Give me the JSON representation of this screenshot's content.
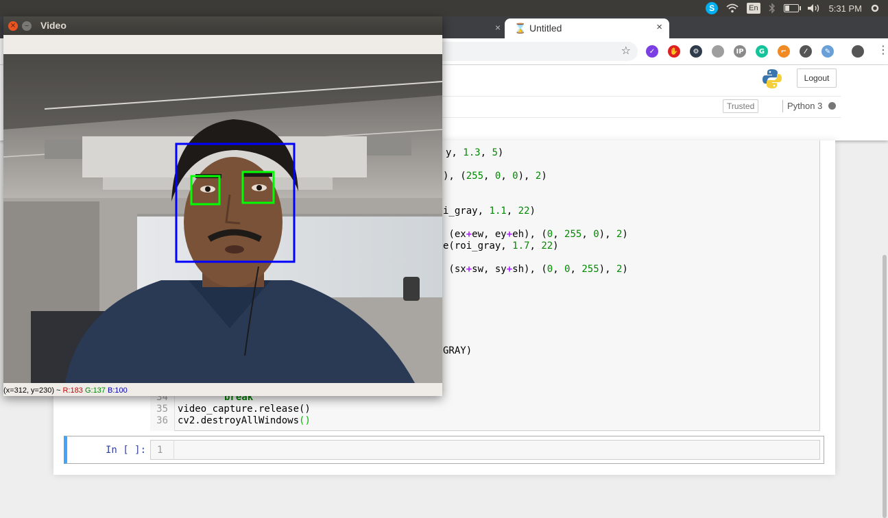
{
  "panel": {
    "lang": "En",
    "time": "5:31 PM",
    "skype_letter": "S"
  },
  "browser": {
    "tab_active_title": "Untitled",
    "tab_close": "×",
    "new_tab": "+",
    "menu_glyph": "⋮",
    "star_glyph": "☆",
    "extensions": [
      {
        "name": "ext-purple-icon",
        "color": "#7b3fe4",
        "glyph": "✓"
      },
      {
        "name": "ext-red-hand-icon",
        "color": "#e02020",
        "glyph": "✋"
      },
      {
        "name": "ext-dark-gear-icon",
        "color": "#2f3b4a",
        "glyph": "⚙"
      },
      {
        "name": "ext-grey-bubble-icon",
        "color": "#9e9e9e",
        "glyph": ""
      },
      {
        "name": "ext-ip-icon",
        "color": "#8a8a8a",
        "glyph": "IP"
      },
      {
        "name": "ext-grammarly-icon",
        "color": "#15c39a",
        "glyph": "G"
      },
      {
        "name": "ext-orange-tool-icon",
        "color": "#f08a24",
        "glyph": "⌐"
      },
      {
        "name": "ext-eyedropper-icon",
        "color": "#555555",
        "glyph": "⁄"
      },
      {
        "name": "ext-color-brush-icon",
        "color": "#6aa0d8",
        "glyph": "✎"
      }
    ]
  },
  "jupyter": {
    "logout": "Logout",
    "trusted": "Trusted",
    "kernel": "Python 3",
    "empty_prompt": "In [ ]:",
    "empty_line_number": "1"
  },
  "code": {
    "line_a": {
      "pre": "y, ",
      "n1": "1.3",
      "mid": ", ",
      "n2": "5",
      "post": ")"
    },
    "line_b": {
      "pre": "), (",
      "n1": "255",
      "c1": ", ",
      "n2": "0",
      "c2": ", ",
      "n3": "0",
      "post": "), ",
      "n4": "2",
      "end": ")"
    },
    "line_c": {
      "pre": "i_gray, ",
      "n1": "1.1",
      "mid": ", ",
      "n2": "22",
      "post": ")"
    },
    "line_d": {
      "pre": " (ex",
      "op1": "+",
      "t1": "ew, ey",
      "op2": "+",
      "t2": "eh), (",
      "n1": "0",
      "c1": ", ",
      "n2": "255",
      "c2": ", ",
      "n3": "0",
      "post": "), ",
      "n4": "2",
      "end": ")"
    },
    "line_e": {
      "pre": "e(roi_gray, ",
      "n1": "1.7",
      "mid": ", ",
      "n2": "22",
      "post": ")"
    },
    "line_f": {
      "pre": " (sx",
      "op1": "+",
      "t1": "sw, sy",
      "op2": "+",
      "t2": "sh), (",
      "n1": "0",
      "c1": ", ",
      "n2": "0",
      "c2": ", ",
      "n3": "255",
      "post": "), ",
      "n4": "2",
      "end": ")"
    },
    "line_g": "GRAY)",
    "line_34": {
      "num": "34",
      "text": "break"
    },
    "line_35": {
      "num": "35",
      "text": "video_capture.release()"
    },
    "line_36": {
      "num": "36",
      "text": "cv2.destroyAllWindows",
      "paren": "()"
    }
  },
  "video_window": {
    "title": "Video",
    "close_glyph": "×",
    "min_glyph": "–",
    "status_coords": "(x=312, y=230) ~ ",
    "status_r": "R:183",
    "status_g": "G:137",
    "status_b": "B:100"
  },
  "colors": {
    "face_box": "#0000ff",
    "eye_box": "#00ff00",
    "jupyter_accent": "#f37626",
    "selected_cell": "#42a5f5"
  }
}
